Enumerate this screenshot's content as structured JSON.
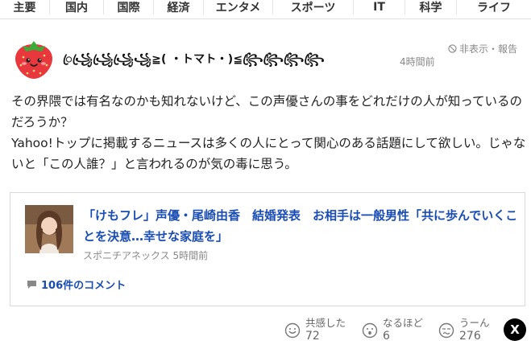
{
  "nav": {
    "items": [
      "主要",
      "国内",
      "国際",
      "経済",
      "エンタメ",
      "スポーツ",
      "IT",
      "科学",
      "ライフ"
    ]
  },
  "comment": {
    "username": "ꦿ꧁ꦿ꧁ꦿ꧁ꦿ꧁≧( ・トマト・)≦꧂ꦿ꧂ꦿ꧂ꦿ꧂ꦿ",
    "timestamp": "4時間前",
    "hide_report": "非表示・報告",
    "body": "その界隈では有名なのかも知れないけど、この声優さんの事をどれだけの人が知っているのだろうか？\nYahoo!トップに掲載するニュースは多くの人にとって関心のある話題にして欲しい。じゃないと「この人誰？」と言われるのが気の毒に思う。"
  },
  "article": {
    "title": "「けもフレ」声優・尾崎由香　結婚発表　お相手は一般男性「共に歩んでいくことを決意…幸せな家庭を」",
    "source": "スポニチアネックス 5時間前",
    "comments": "106件のコメント"
  },
  "reactions": [
    {
      "label": "共感した",
      "count": "72",
      "icon": "smile-face-icon"
    },
    {
      "label": "なるほど",
      "count": "6",
      "icon": "surprised-face-icon"
    },
    {
      "label": "うーん",
      "count": "276",
      "icon": "confused-face-icon"
    }
  ],
  "share": {
    "x_label": "X"
  },
  "colors": {
    "link": "#1a4db3",
    "muted": "#888888"
  }
}
